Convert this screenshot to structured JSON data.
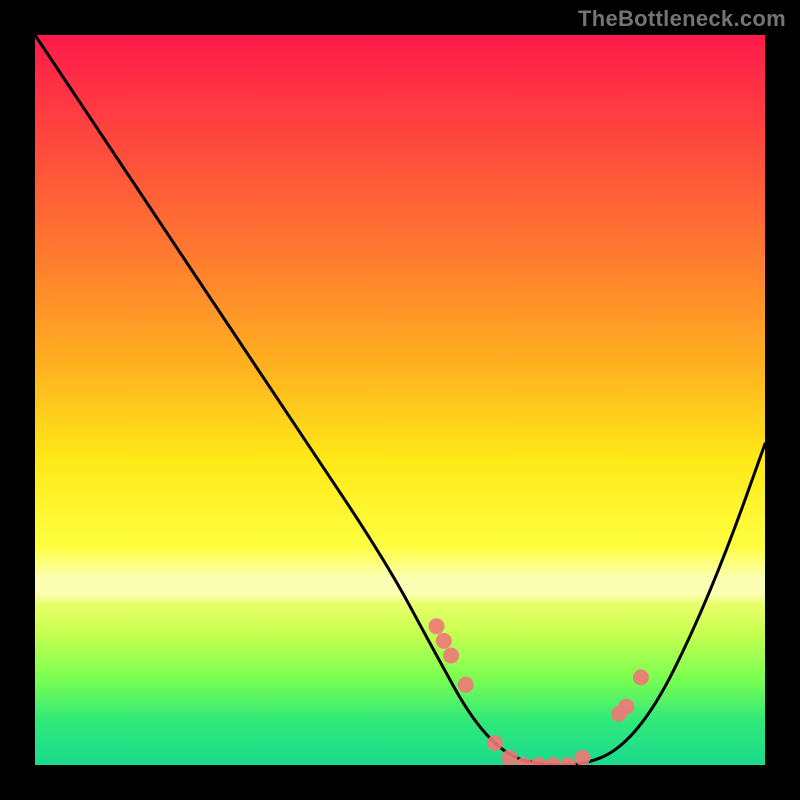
{
  "watermark": "TheBottleneck.com",
  "chart_data": {
    "type": "line",
    "title": "",
    "xlabel": "",
    "ylabel": "",
    "xlim": [
      0,
      100
    ],
    "ylim": [
      0,
      100
    ],
    "series": [
      {
        "name": "bottleneck-curve",
        "x": [
          0,
          12,
          24,
          36,
          48,
          55,
          60,
          65,
          70,
          75,
          80,
          85,
          90,
          95,
          100
        ],
        "values": [
          100,
          82,
          64,
          46,
          28,
          15,
          6,
          1,
          0,
          0,
          2,
          8,
          18,
          30,
          44
        ]
      }
    ],
    "markers": {
      "name": "highlighted-points",
      "x": [
        55,
        56,
        57,
        59,
        63,
        65,
        67,
        69,
        71,
        73,
        75,
        80,
        81,
        83
      ],
      "values": [
        19,
        17,
        15,
        11,
        3,
        1,
        0,
        0,
        0,
        0,
        1,
        7,
        8,
        12
      ]
    },
    "gradient_stops": [
      {
        "pos": 0,
        "color": "#ff1a4a"
      },
      {
        "pos": 30,
        "color": "#ff7a30"
      },
      {
        "pos": 58,
        "color": "#ffe818"
      },
      {
        "pos": 75,
        "color": "#fbffb4"
      },
      {
        "pos": 100,
        "color": "#1adb8c"
      }
    ]
  }
}
